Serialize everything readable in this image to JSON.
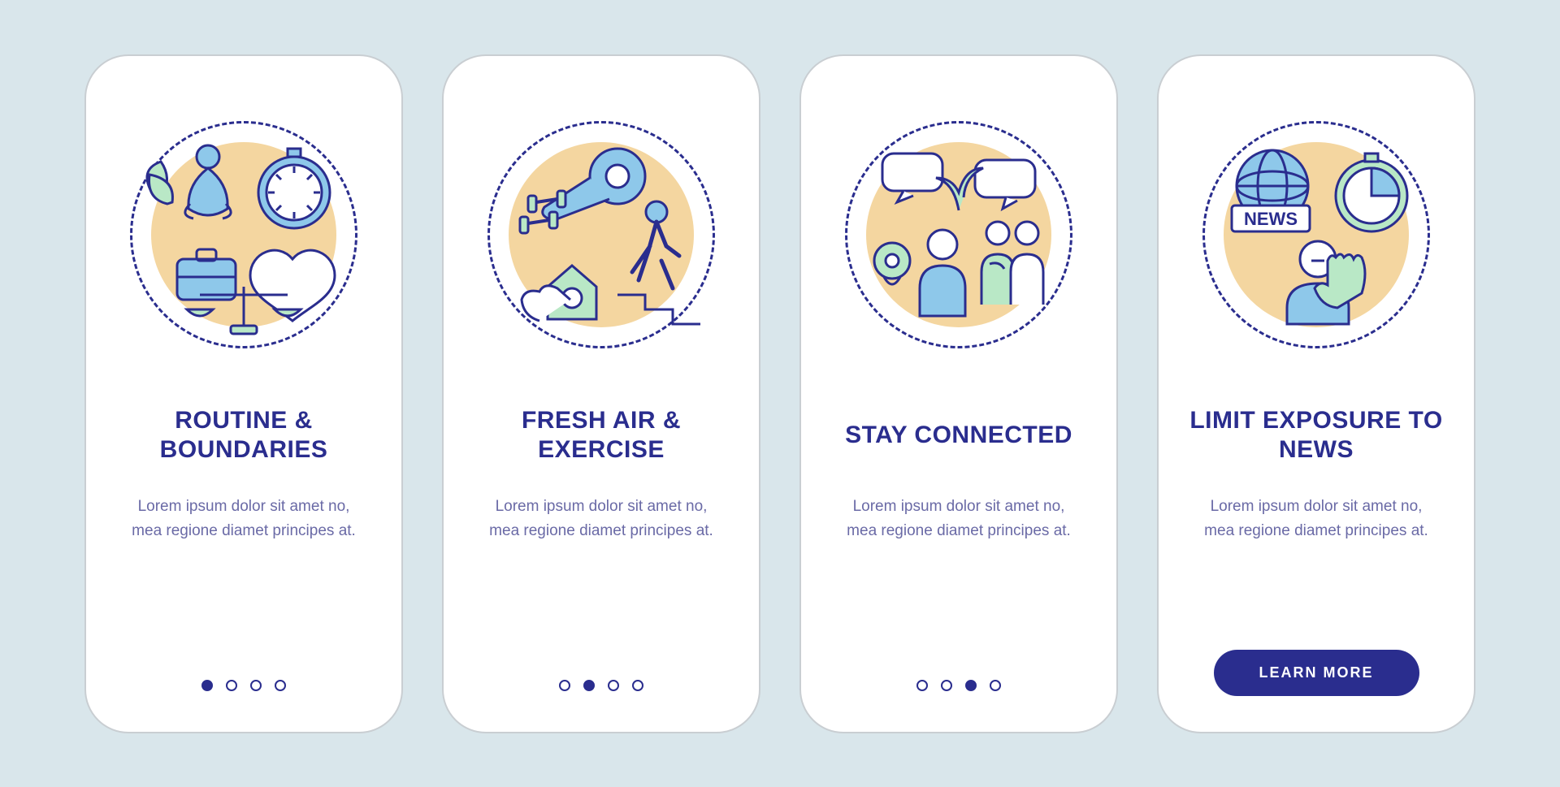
{
  "colors": {
    "background": "#d9e6eb",
    "card": "#ffffff",
    "indigo": "#2a2d8e",
    "text": "#6a6aa6",
    "amber": "#f4d6a0",
    "blue": "#8ec8ea",
    "green": "#b9e8c6"
  },
  "cards": [
    {
      "title": "Routine & Boundaries",
      "body": "Lorem ipsum dolor sit amet no, mea regione diamet principes at.",
      "activeDot": 0,
      "hasCta": false,
      "icon": "routine-boundaries-icon",
      "illustration": {
        "meditation": true,
        "stopwatch": true,
        "briefcase": true,
        "heart": true,
        "leaves": true,
        "scales": true
      }
    },
    {
      "title": "Fresh air & Exercise",
      "body": "Lorem ipsum dolor sit amet no, mea regione diamet principes at.",
      "activeDot": 1,
      "hasCta": false,
      "icon": "fresh-air-exercise-icon",
      "illustration": {
        "yogaMat": true,
        "dumbbell": true,
        "walking": true,
        "house": true,
        "hand": true
      }
    },
    {
      "title": "Stay Connected",
      "body": "Lorem ipsum dolor sit amet no, mea regione diamet principes at.",
      "activeDot": 2,
      "hasCta": false,
      "icon": "stay-connected-icon",
      "illustration": {
        "speechBubbles": true,
        "plant": true,
        "webcam": true,
        "people": true
      }
    },
    {
      "title": "Limit Exposure To News",
      "body": "Lorem ipsum dolor sit amet no, mea regione diamet principes at.",
      "activeDot": null,
      "hasCta": true,
      "cta": "LEARN MORE",
      "icon": "limit-news-icon",
      "illustration": {
        "globe": true,
        "newsLabel": "NEWS",
        "timer": true,
        "personHand": true
      }
    }
  ]
}
